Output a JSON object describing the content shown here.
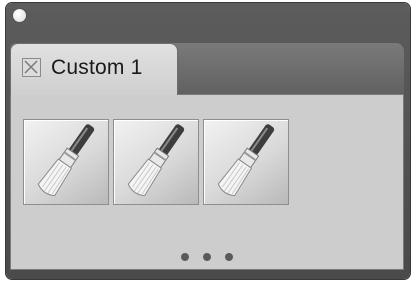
{
  "window": {
    "close_button": "close-dot"
  },
  "tab": {
    "label": "Custom 1",
    "close_icon": "close-x-icon"
  },
  "brushes": [
    {
      "icon": "paintbrush-icon"
    },
    {
      "icon": "paintbrush-icon"
    },
    {
      "icon": "paintbrush-icon"
    }
  ],
  "more_indicator": {
    "icon": "more-dots-icon"
  },
  "colors": {
    "frame": "#555555",
    "tab": "#d8d8d8",
    "content": "#cdcdcd"
  }
}
